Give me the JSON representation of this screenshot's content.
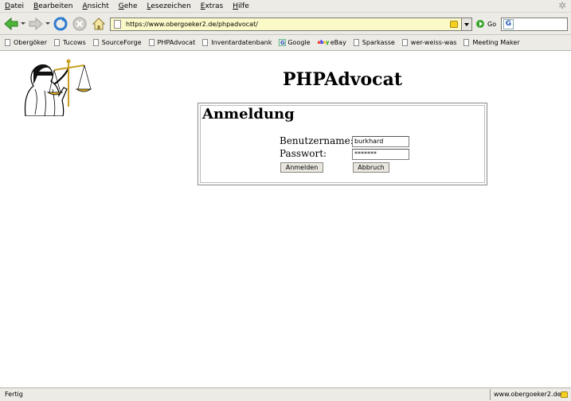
{
  "menu": [
    "Datei",
    "Bearbeiten",
    "Ansicht",
    "Gehe",
    "Lesezeichen",
    "Extras",
    "Hilfe"
  ],
  "navbar": {
    "url": "https://www.obergoeker2.de/phpadvocat/",
    "go_label": "Go",
    "search_value": ""
  },
  "bookmarks": [
    {
      "label": "Obergöker",
      "icon": "page-icon"
    },
    {
      "label": "Tucows",
      "icon": "page-icon"
    },
    {
      "label": "SourceForge",
      "icon": "page-icon"
    },
    {
      "label": "PHPAdvocat",
      "icon": "page-icon"
    },
    {
      "label": "Inventardatenbank",
      "icon": "page-icon"
    },
    {
      "label": "Google",
      "icon": "google-icon"
    },
    {
      "label": "eBay",
      "icon": "ebay-icon"
    },
    {
      "label": "Sparkasse",
      "icon": "page-icon"
    },
    {
      "label": "wer-weiss-was",
      "icon": "page-icon"
    },
    {
      "label": "Meeting Maker",
      "icon": "page-icon"
    }
  ],
  "page": {
    "title": "PHPAdvocat",
    "login": {
      "heading": "Anmeldung",
      "username_label": "Benutzername:",
      "username_value": "burkhard",
      "password_label": "Passwort:",
      "password_value": "*******",
      "submit_label": "Anmelden",
      "cancel_label": "Abbruch"
    }
  },
  "status": {
    "text": "Fertig",
    "domain": "www.obergoeker2.de"
  }
}
